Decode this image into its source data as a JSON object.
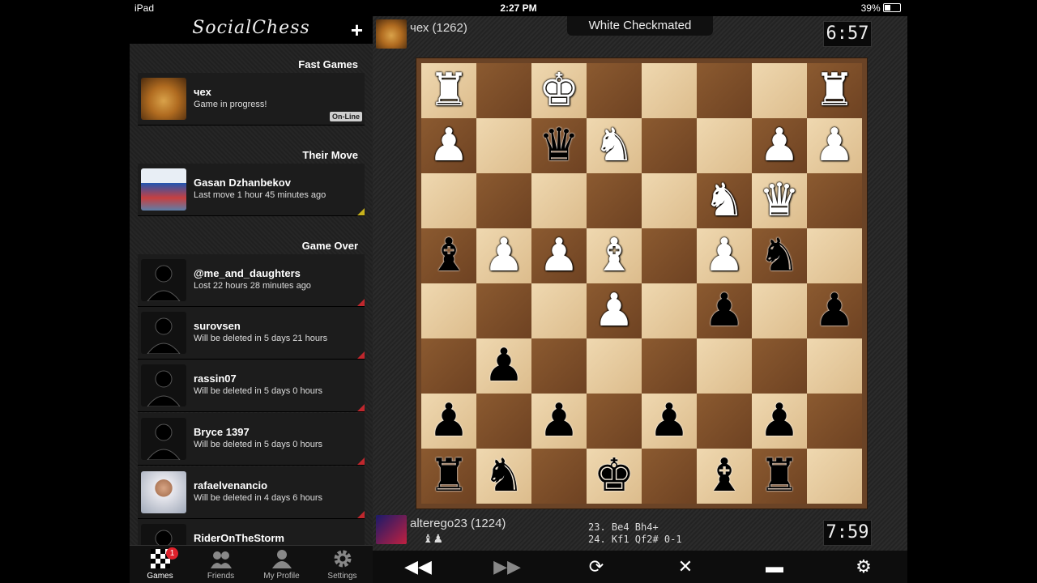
{
  "status_bar": {
    "device": "iPad",
    "time": "2:27 PM",
    "battery": "39%"
  },
  "app": {
    "title": "SocialChess"
  },
  "sections": {
    "fast": "Fast Games",
    "their": "Their Move",
    "over": "Game Over"
  },
  "fast_games": [
    {
      "name": "чех",
      "status": "Game in progress!",
      "badge": "On-Line"
    }
  ],
  "their_move": [
    {
      "name": "Gasan Dzhanbekov",
      "status": "Last move 1 hour 45 minutes ago"
    }
  ],
  "game_over": [
    {
      "name": "@me_and_daughters",
      "status": "Lost 22 hours 28 minutes ago"
    },
    {
      "name": "surovsen",
      "status": "Will be deleted in 5 days 21 hours"
    },
    {
      "name": "rassin07",
      "status": "Will be deleted in 5 days 0 hours"
    },
    {
      "name": "Bryce 1397",
      "status": "Will be deleted in 5 days 0 hours"
    },
    {
      "name": "rafaelvenancio",
      "status": "Will be deleted in 4 days 6 hours"
    },
    {
      "name": "RiderOnTheStorm",
      "status": ""
    }
  ],
  "tabs": [
    {
      "label": "Games",
      "icon": "checkerboard-icon",
      "badge": "1"
    },
    {
      "label": "Friends",
      "icon": "friends-icon"
    },
    {
      "label": "My Profile",
      "icon": "person-icon"
    },
    {
      "label": "Settings",
      "icon": "gear-icon"
    }
  ],
  "game": {
    "top_player": "чех (1262)",
    "result": "White Checkmated",
    "top_clock": "6:57",
    "bottom_player": "alterego23 (1224)",
    "bottom_clock": "7:59",
    "move_line_1": "23. Be4 Bh4+",
    "move_line_2": "24. Kf1 Qf2# 0-1",
    "captured": "♝♟"
  },
  "board": [
    [
      "wR",
      "",
      "wK",
      "",
      "",
      "",
      "",
      "wR"
    ],
    [
      "wP",
      "",
      "bQ",
      "wN",
      "",
      "",
      "wP",
      "wP"
    ],
    [
      "",
      "",
      "",
      "",
      "",
      "wN",
      "wQ",
      ""
    ],
    [
      "bB",
      "wP",
      "wP",
      "wB",
      "",
      "wP",
      "bN",
      ""
    ],
    [
      "",
      "",
      "",
      "wP",
      "",
      "bP",
      "",
      "bP"
    ],
    [
      "",
      "bP",
      "",
      "",
      "",
      "",
      "",
      ""
    ],
    [
      "bP",
      "",
      "bP",
      "",
      "bP",
      "",
      "bP",
      ""
    ],
    [
      "bR",
      "bN",
      "",
      "bK",
      "",
      "bB",
      "bR",
      ""
    ]
  ],
  "toolbar": [
    "rewind-icon",
    "fast-forward-icon",
    "refresh-icon",
    "close-icon",
    "chat-icon",
    "gear-icon"
  ]
}
